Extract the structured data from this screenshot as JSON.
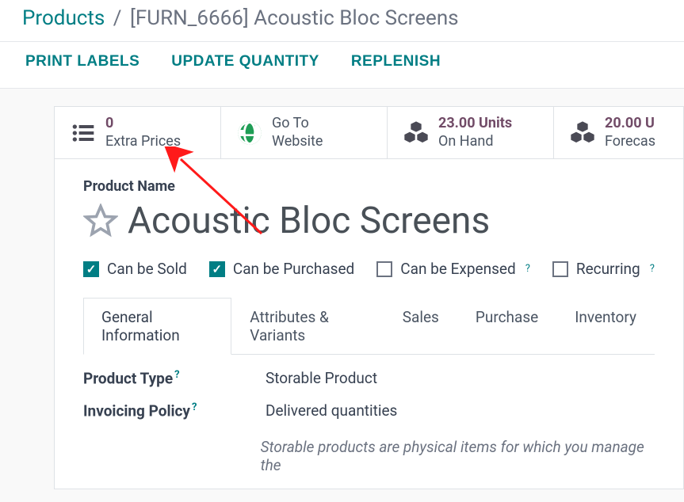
{
  "breadcrumb": {
    "root": "Products",
    "sep": "/",
    "current": "[FURN_6666] Acoustic Bloc Screens"
  },
  "actions": {
    "print_labels": "PRINT LABELS",
    "update_quantity": "UPDATE QUANTITY",
    "replenish": "REPLENISH"
  },
  "stats": {
    "extra_prices": {
      "value": "0",
      "label": "Extra Prices"
    },
    "website": {
      "line1": "Go To",
      "line2": "Website"
    },
    "on_hand": {
      "value": "23.00 Units",
      "label": "On Hand"
    },
    "forecast": {
      "value": "20.00 U",
      "label": "Forecas"
    }
  },
  "form": {
    "name_label": "Product Name",
    "name": "Acoustic Bloc Screens"
  },
  "checks": {
    "sold": "Can be Sold",
    "purchased": "Can be Purchased",
    "expensed": "Can be Expensed",
    "recurring": "Recurring"
  },
  "tabs": {
    "general": "General Information",
    "attributes": "Attributes & Variants",
    "sales": "Sales",
    "purchase": "Purchase",
    "inventory": "Inventory"
  },
  "fields": {
    "product_type_label": "Product Type",
    "product_type_value": "Storable Product",
    "invoicing_label": "Invoicing Policy",
    "invoicing_value": "Delivered quantities",
    "hint": "Storable products are physical items for which you manage the"
  }
}
